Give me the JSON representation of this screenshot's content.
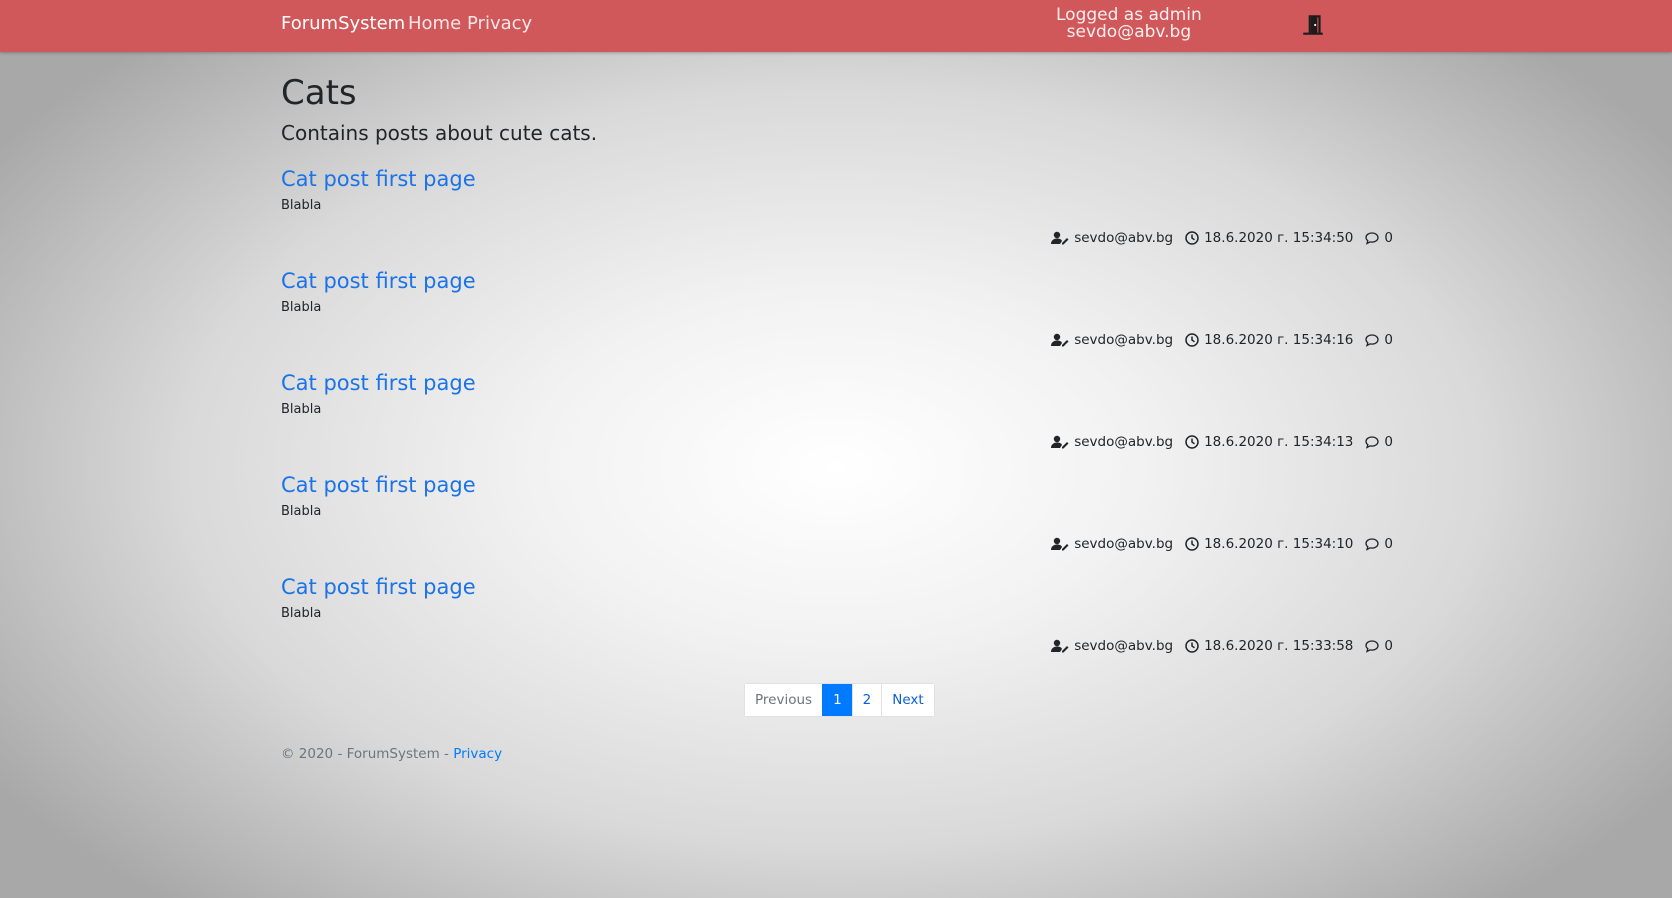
{
  "nav": {
    "brand": "ForumSystem",
    "links": [
      "Home",
      "Privacy"
    ],
    "login_line1": "Logged as admin",
    "login_line2": "sevdo@abv.bg",
    "logout_icon": "door-exit-icon",
    "bg_color": "#d0585a"
  },
  "page": {
    "title": "Cats",
    "description": "Contains posts about cute cats."
  },
  "posts": [
    {
      "title": "Cat post first page",
      "body": "Blabla",
      "author": "sevdo@abv.bg",
      "time": "18.6.2020 г. 15:34:50",
      "comments": "0"
    },
    {
      "title": "Cat post first page",
      "body": "Blabla",
      "author": "sevdo@abv.bg",
      "time": "18.6.2020 г. 15:34:16",
      "comments": "0"
    },
    {
      "title": "Cat post first page",
      "body": "Blabla",
      "author": "sevdo@abv.bg",
      "time": "18.6.2020 г. 15:34:13",
      "comments": "0"
    },
    {
      "title": "Cat post first page",
      "body": "Blabla",
      "author": "sevdo@abv.bg",
      "time": "18.6.2020 г. 15:34:10",
      "comments": "0"
    },
    {
      "title": "Cat post first page",
      "body": "Blabla",
      "author": "sevdo@abv.bg",
      "time": "18.6.2020 г. 15:33:58",
      "comments": "0"
    }
  ],
  "pagination": {
    "previous": "Previous",
    "pages": [
      "1",
      "2"
    ],
    "active_page": "1",
    "next": "Next"
  },
  "footer": {
    "text": "© 2020 - ForumSystem - ",
    "link": "Privacy"
  }
}
